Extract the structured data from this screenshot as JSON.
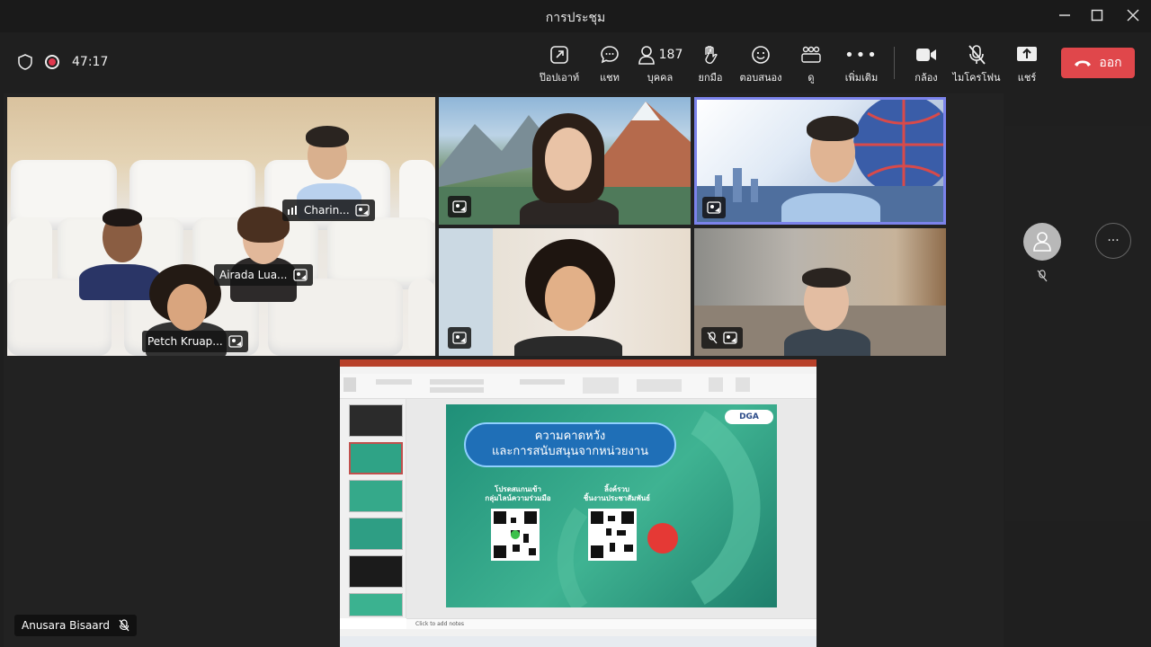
{
  "window": {
    "title": "การประชุม"
  },
  "meeting": {
    "elapsed": "47:17"
  },
  "toolbar": {
    "popout_label": "ป๊อปเอาท์",
    "chat_label": "แชท",
    "people_label": "บุคคล",
    "people_count": "187",
    "raise_label": "ยกมือ",
    "react_label": "ตอบสนอง",
    "view_label": "ดู",
    "more_label": "เพิ่มเติม",
    "camera_label": "กล้อง",
    "mic_label": "ไมโครโฟน",
    "share_label": "แชร์",
    "leave_label": "ออก"
  },
  "participants": [
    {
      "name": "Charin..."
    },
    {
      "name": "Airada Lua..."
    },
    {
      "name": "Petch Kruap..."
    }
  ],
  "self": {
    "name": "Anusara Bisaard"
  },
  "share": {
    "notes_placeholder": "Click to add notes",
    "slide": {
      "heading_line1": "ความคาดหวัง",
      "heading_line2": "และการสนับสนุนจากหน่วยงาน",
      "qr1_line1": "โปรดสแกนเข้า",
      "qr1_line2": "กลุ่มไลน์ความร่วมมือ",
      "qr2_line1": "ลิ้งค์รวบ",
      "qr2_line2": "ชิ้นงานประชาสัมพันธ์",
      "logo_text": "DGA"
    }
  },
  "colors": {
    "leave": "#e0474b",
    "active_speaker_border": "#7b83eb",
    "slide_green": "#2fa386"
  }
}
